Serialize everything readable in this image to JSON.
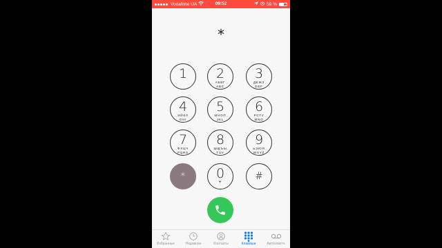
{
  "status_bar": {
    "carrier": "Vodafone UA",
    "time": "09:52",
    "battery": "59 %",
    "battery_level": 0.59
  },
  "dialer": {
    "entered": "*"
  },
  "keypad": [
    {
      "digit": "1",
      "letters": "",
      "letters2": ""
    },
    {
      "digit": "2",
      "letters": "АБВГ",
      "letters2": "ABC"
    },
    {
      "digit": "3",
      "letters": "ДЕЖЗ",
      "letters2": "DEF"
    },
    {
      "digit": "4",
      "letters": "ИЙКЛ",
      "letters2": "GHI"
    },
    {
      "digit": "5",
      "letters": "МНОП",
      "letters2": "JKL"
    },
    {
      "digit": "6",
      "letters": "РСТУ",
      "letters2": "MNO"
    },
    {
      "digit": "7",
      "letters": "ФХЦЧ",
      "letters2": "PQRS"
    },
    {
      "digit": "8",
      "letters": "ШЩЪЫ",
      "letters2": "TUV"
    },
    {
      "digit": "9",
      "letters": "ЬЭЮЯ",
      "letters2": "WXYZ"
    },
    {
      "digit": "*",
      "letters": "",
      "letters2": ""
    },
    {
      "digit": "0",
      "letters": "+",
      "letters2": ""
    },
    {
      "digit": "#",
      "letters": "",
      "letters2": ""
    }
  ],
  "tabs": [
    {
      "label": "Избранные",
      "icon": "star-icon"
    },
    {
      "label": "Недавние",
      "icon": "clock-icon"
    },
    {
      "label": "Контакты",
      "icon": "person-icon"
    },
    {
      "label": "Клавиши",
      "icon": "keypad-icon"
    },
    {
      "label": "Автоответч.",
      "icon": "voicemail-icon"
    }
  ],
  "colors": {
    "status_bar": "#ff4a3d",
    "call_button": "#35c759",
    "active_tab": "#1479f6",
    "pressed_key": "#8a7a80"
  }
}
